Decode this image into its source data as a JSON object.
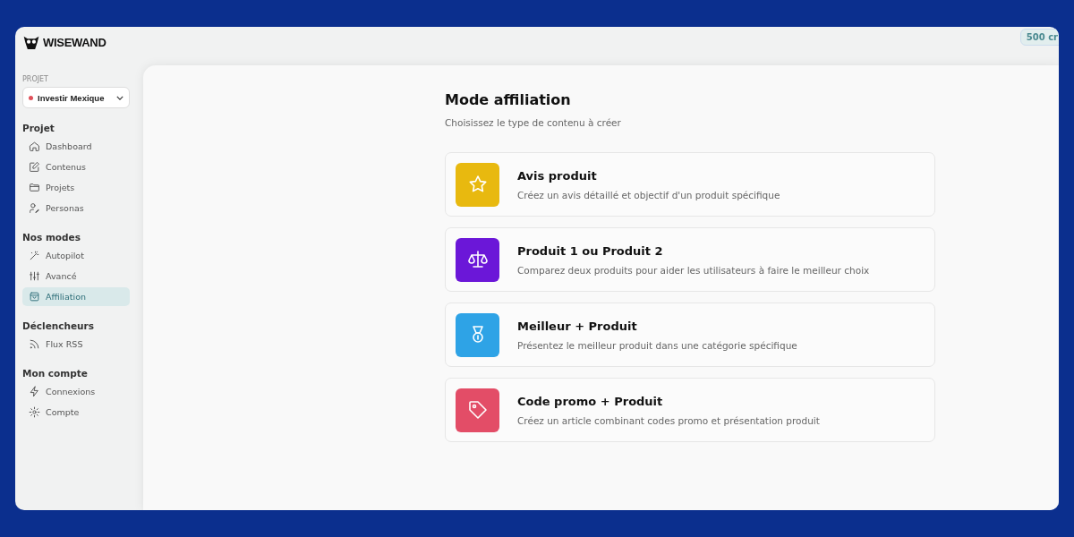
{
  "logo": {
    "text": "WISEWAND"
  },
  "credits": {
    "text": "500 cr"
  },
  "project_selector": {
    "label": "PROJET",
    "value": "Investir Mexique",
    "color": "#e0505a"
  },
  "sidebar": {
    "sections": [
      {
        "title": "Projet",
        "items": [
          {
            "label": "Dashboard",
            "selected": false
          },
          {
            "label": "Contenus",
            "selected": false
          },
          {
            "label": "Projets",
            "selected": false
          },
          {
            "label": "Personas",
            "selected": false
          }
        ]
      },
      {
        "title": "Nos modes",
        "items": [
          {
            "label": "Autopilot",
            "selected": false
          },
          {
            "label": "Avancé",
            "selected": false
          },
          {
            "label": "Affiliation",
            "selected": true
          }
        ]
      },
      {
        "title": "Déclencheurs",
        "items": [
          {
            "label": "Flux RSS",
            "selected": false
          }
        ]
      },
      {
        "title": "Mon compte",
        "items": [
          {
            "label": "Connexions",
            "selected": false
          },
          {
            "label": "Compte",
            "selected": false
          }
        ]
      }
    ]
  },
  "main": {
    "title": "Mode affiliation",
    "subtitle": "Choisissez le type de contenu à créer",
    "options": [
      {
        "title": "Avis produit",
        "description": "Créez un avis détaillé et objectif d'un produit spécifique",
        "color": "#e8b90f"
      },
      {
        "title": "Produit 1 ou Produit 2",
        "description": "Comparez deux produits pour aider les utilisateurs à faire le meilleur choix",
        "color": "#6b17d8"
      },
      {
        "title": "Meilleur + Produit",
        "description": "Présentez le meilleur produit dans une catégorie spécifique",
        "color": "#2ea3e6"
      },
      {
        "title": "Code promo + Produit",
        "description": "Créez un article combinant codes promo et présentation produit",
        "color": "#e34d67"
      }
    ]
  }
}
